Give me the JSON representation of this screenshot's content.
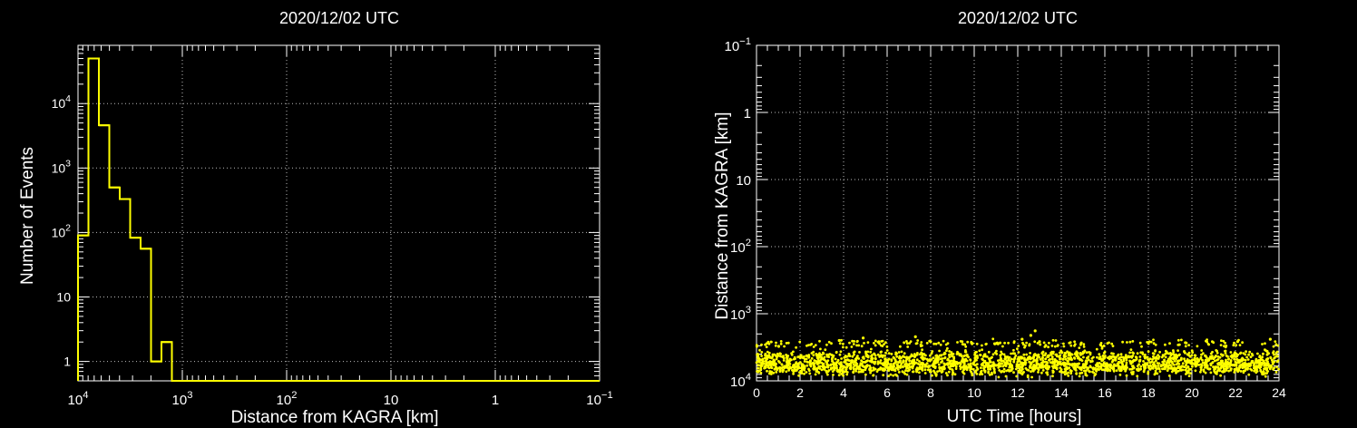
{
  "chart_data": [
    {
      "type": "bar",
      "style": "step-histogram",
      "title": "2020/12/02 UTC",
      "xlabel": "Distance from KAGRA [km]",
      "ylabel": "Number of Events",
      "x_scale": "log",
      "x_reversed": true,
      "y_scale": "log",
      "xlim": [
        10000,
        0.1
      ],
      "ylim": [
        0.5,
        80000
      ],
      "x_ticks": [
        {
          "label": "10",
          "sup": "4"
        },
        {
          "label": "10",
          "sup": "3"
        },
        {
          "label": "10",
          "sup": "2"
        },
        {
          "label": "10",
          "sup": ""
        },
        {
          "label": "1",
          "sup": ""
        },
        {
          "label": "10",
          "sup": "−1"
        }
      ],
      "y_ticks": [
        {
          "label": "1",
          "sup": ""
        },
        {
          "label": "10",
          "sup": ""
        },
        {
          "label": "10",
          "sup": "2"
        },
        {
          "label": "10",
          "sup": "3"
        },
        {
          "label": "10",
          "sup": "4"
        }
      ],
      "grid": true,
      "color": "#ffff00",
      "bins_desc_km": [
        {
          "hi": 10000,
          "lo": 7943,
          "count": 90
        },
        {
          "hi": 7943,
          "lo": 6310,
          "count": 50000
        },
        {
          "hi": 6310,
          "lo": 5012,
          "count": 4600
        },
        {
          "hi": 5012,
          "lo": 3981,
          "count": 500
        },
        {
          "hi": 3981,
          "lo": 3162,
          "count": 330
        },
        {
          "hi": 3162,
          "lo": 2512,
          "count": 83
        },
        {
          "hi": 2512,
          "lo": 1995,
          "count": 56
        },
        {
          "hi": 1995,
          "lo": 1585,
          "count": 1
        },
        {
          "hi": 1585,
          "lo": 1259,
          "count": 2
        },
        {
          "hi": 1259,
          "lo": 0.1,
          "count": 0
        }
      ]
    },
    {
      "type": "scatter",
      "title": "2020/12/02 UTC",
      "xlabel": "UTC Time [hours]",
      "ylabel": "Distance from KAGRA [km]",
      "xlim": [
        0,
        24
      ],
      "y_scale": "log",
      "y_reversed": true,
      "ylim": [
        10000,
        0.1
      ],
      "x_ticks": [
        "0",
        "2",
        "4",
        "6",
        "8",
        "10",
        "12",
        "14",
        "16",
        "18",
        "20",
        "22",
        "24"
      ],
      "y_ticks": [
        {
          "label": "10",
          "sup": "−1"
        },
        {
          "label": "1",
          "sup": ""
        },
        {
          "label": "10",
          "sup": ""
        },
        {
          "label": "10",
          "sup": "2"
        },
        {
          "label": "10",
          "sup": "3"
        },
        {
          "label": "10",
          "sup": "4"
        }
      ],
      "grid": true,
      "color": "#ffff00",
      "bands": [
        {
          "distance_km": 6000,
          "spread": 0.55,
          "density": 1.0
        },
        {
          "distance_km": 4200,
          "spread": 0.35,
          "density": 0.35
        },
        {
          "distance_km": 2800,
          "spread": 0.25,
          "density": 0.12
        }
      ],
      "outliers": [
        {
          "hour": 12.8,
          "distance_km": 1800
        },
        {
          "hour": 12.6,
          "distance_km": 2100
        },
        {
          "hour": 13.0,
          "distance_km": 2600
        },
        {
          "hour": 4.9,
          "distance_km": 2300
        },
        {
          "hour": 7.3,
          "distance_km": 2200
        },
        {
          "hour": 3.8,
          "distance_km": 2500
        },
        {
          "hour": 23.6,
          "distance_km": 2400
        },
        {
          "hour": 22.1,
          "distance_km": 2600
        },
        {
          "hour": 12.2,
          "distance_km": 2400
        },
        {
          "hour": 19.7,
          "distance_km": 2700
        }
      ]
    }
  ]
}
